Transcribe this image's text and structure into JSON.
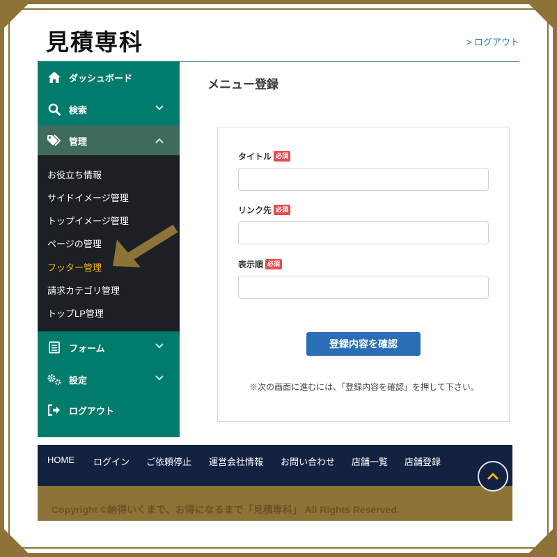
{
  "header": {
    "logo_text": "見積専科",
    "logout_link": "> ログアウト"
  },
  "sidebar": {
    "items": [
      {
        "label": "ダッシュボード",
        "icon": "home-icon"
      },
      {
        "label": "検索",
        "icon": "search-icon"
      },
      {
        "label": "管理",
        "icon": "tags-icon"
      },
      {
        "label": "フォーム",
        "icon": "form-icon"
      },
      {
        "label": "設定",
        "icon": "gears-icon"
      },
      {
        "label": "ログアウト",
        "icon": "sign-out-icon"
      }
    ],
    "submenu": [
      "お役立ち情報",
      "サイドイメージ管理",
      "トップイメージ管理",
      "ページの管理",
      "フッター管理",
      "請求カテゴリ管理",
      "トップLP管理"
    ],
    "current_submenu": "フッター管理"
  },
  "main": {
    "title": "メニュー登録",
    "required_badge": "必須",
    "fields": [
      {
        "label": "タイトル",
        "value": "",
        "placeholder": ""
      },
      {
        "label": "リンク先",
        "value": "",
        "placeholder": ""
      },
      {
        "label": "表示順",
        "value": "",
        "placeholder": ""
      }
    ],
    "confirm_button": "登録内容を確認",
    "note": "※次の画面に進むには、「登録内容を確認」を押して下さい。"
  },
  "footer": {
    "links": [
      "HOME",
      "ログイン",
      "ご依頼停止",
      "運営会社情報",
      "お問い合わせ",
      "店舗一覧",
      "店舗登録"
    ],
    "copyright": "Copyright ©納得いくまで、お得になるまで「見積専科」 All Rights Reserved."
  },
  "colors": {
    "sidebar": "#007b6c",
    "submenu_bg": "#1c1f24",
    "active_submenu": "#f2b705",
    "frame_gold": "#8d7338",
    "footer_navy": "#142241",
    "button_blue": "#2a6fb5",
    "required_red": "#e74c4c"
  }
}
